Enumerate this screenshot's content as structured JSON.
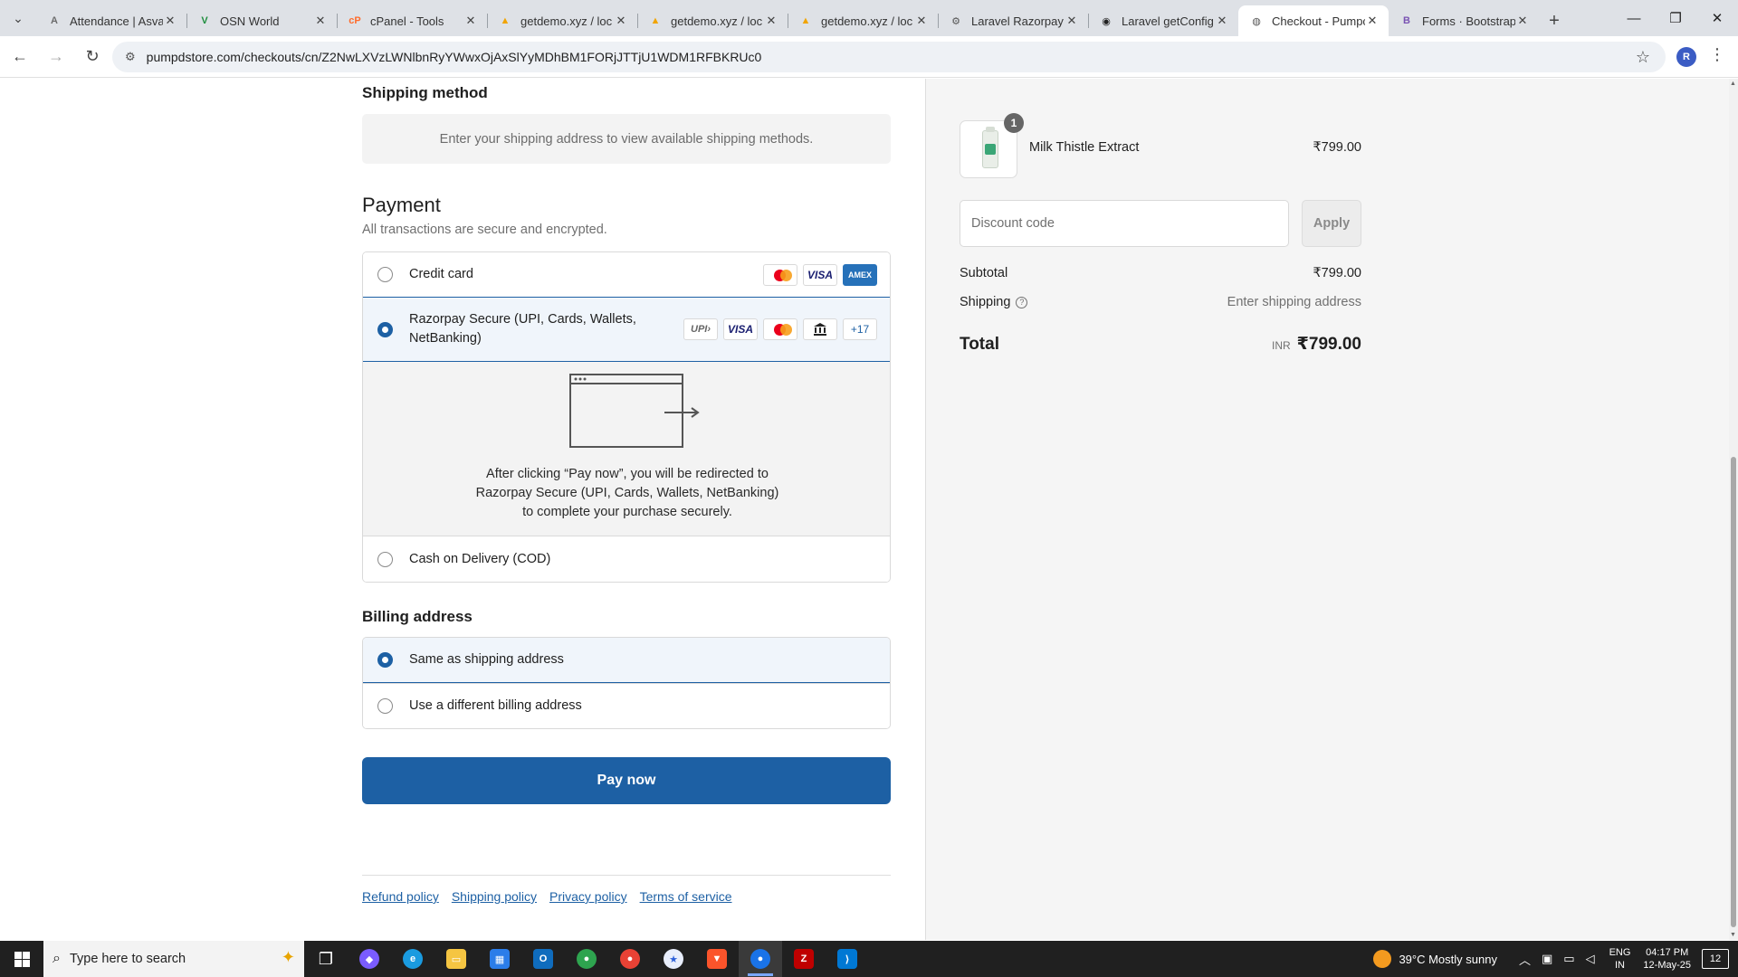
{
  "browser": {
    "tabs": [
      {
        "label": "Attendance | Asva",
        "icon": "A",
        "color": "#6b6b6b"
      },
      {
        "label": "OSN World",
        "icon": "V",
        "color": "#1e8e3e"
      },
      {
        "label": "cPanel - Tools",
        "icon": "cP",
        "color": "#ff6c2c"
      },
      {
        "label": "getdemo.xyz / loc",
        "icon": "▲",
        "color": "#f1a400"
      },
      {
        "label": "getdemo.xyz / loc",
        "icon": "▲",
        "color": "#f1a400"
      },
      {
        "label": "getdemo.xyz / loc",
        "icon": "▲",
        "color": "#f1a400"
      },
      {
        "label": "Laravel Razorpay",
        "icon": "⚙",
        "color": "#555555"
      },
      {
        "label": "Laravel getConfig",
        "icon": "◉",
        "color": "#222222"
      },
      {
        "label": "Checkout - Pumpc",
        "icon": "◍",
        "color": "#555555"
      },
      {
        "label": "Forms · Bootstrap",
        "icon": "B",
        "color": "#7952b3"
      }
    ],
    "active_tab": 8,
    "url": "pumpdstore.com/checkouts/cn/Z2NwLXVzLWNlbnRyYWwxOjAxSlYyMDhBM1FORjJTTjU1WDM1RFBKRUc0",
    "profile_initial": "R"
  },
  "shipping_method": {
    "title": "Shipping method",
    "message": "Enter your shipping address to view available shipping methods."
  },
  "payment": {
    "title": "Payment",
    "subtitle": "All transactions are secure and encrypted.",
    "options": {
      "credit_card": "Credit card",
      "razorpay": "Razorpay Secure (UPI, Cards, Wallets, NetBanking)",
      "cod": "Cash on Delivery (COD)"
    },
    "card_brands": {
      "visa": "VISA",
      "amex": "AMEX",
      "upi": "UPI›",
      "more": "+17"
    },
    "redirect_message": "After clicking “Pay now”, you will be redirected to Razorpay Secure (UPI, Cards, Wallets, NetBanking) to complete your purchase securely."
  },
  "billing": {
    "title": "Billing address",
    "same": "Same as shipping address",
    "different": "Use a different billing address"
  },
  "pay_button": "Pay now",
  "footer_links": [
    "Refund policy",
    "Shipping policy",
    "Privacy policy",
    "Terms of service"
  ],
  "summary": {
    "product_name": "Milk Thistle Extract",
    "product_qty": "1",
    "product_price": "₹799.00",
    "discount_placeholder": "Discount code",
    "apply_label": "Apply",
    "subtotal_label": "Subtotal",
    "subtotal_value": "₹799.00",
    "shipping_label": "Shipping",
    "shipping_value": "Enter shipping address",
    "total_label": "Total",
    "currency": "INR",
    "total_value": "₹799.00"
  },
  "taskbar": {
    "search_placeholder": "Type here to search",
    "weather": "39°C  Mostly sunny",
    "lang_top": "ENG",
    "lang_bottom": "IN",
    "time": "04:17 PM",
    "date": "12-May-25",
    "notifications": "12"
  },
  "colors": {
    "accent": "#1d60a4"
  }
}
